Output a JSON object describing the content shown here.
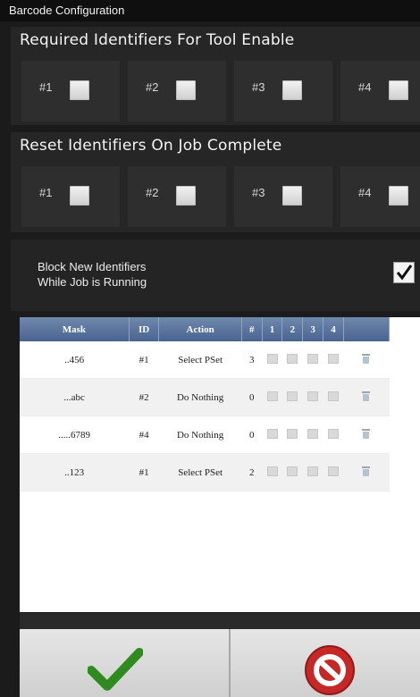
{
  "window": {
    "title": "Barcode Configuration"
  },
  "required": {
    "title": "Required Identifiers For Tool Enable",
    "items": [
      "#1",
      "#2",
      "#3",
      "#4"
    ]
  },
  "reset": {
    "title": "Reset Identifiers On Job Complete",
    "items": [
      "#1",
      "#2",
      "#3",
      "#4"
    ]
  },
  "block": {
    "line1": "Block New Identifiers",
    "line2": "While Job is Running"
  },
  "table": {
    "headers": [
      "Mask",
      "ID",
      "Action",
      "#",
      "1",
      "2",
      "3",
      "4"
    ],
    "rows": [
      {
        "mask": "..456",
        "id": "#1",
        "action": "Select PSet",
        "count": "3"
      },
      {
        "mask": "...abc",
        "id": "#2",
        "action": "Do Nothing",
        "count": "0"
      },
      {
        "mask": ".....6789",
        "id": "#4",
        "action": "Do Nothing",
        "count": "0"
      },
      {
        "mask": "..123",
        "id": "#1",
        "action": "Select PSet",
        "count": "2"
      }
    ]
  },
  "buttons": {
    "ok_icon": "checkmark-icon",
    "cancel_icon": "cancel-icon"
  },
  "colors": {
    "header_blue": "#4a6490",
    "ok_green": "#2e8b1e",
    "cancel_red": "#c62828"
  }
}
